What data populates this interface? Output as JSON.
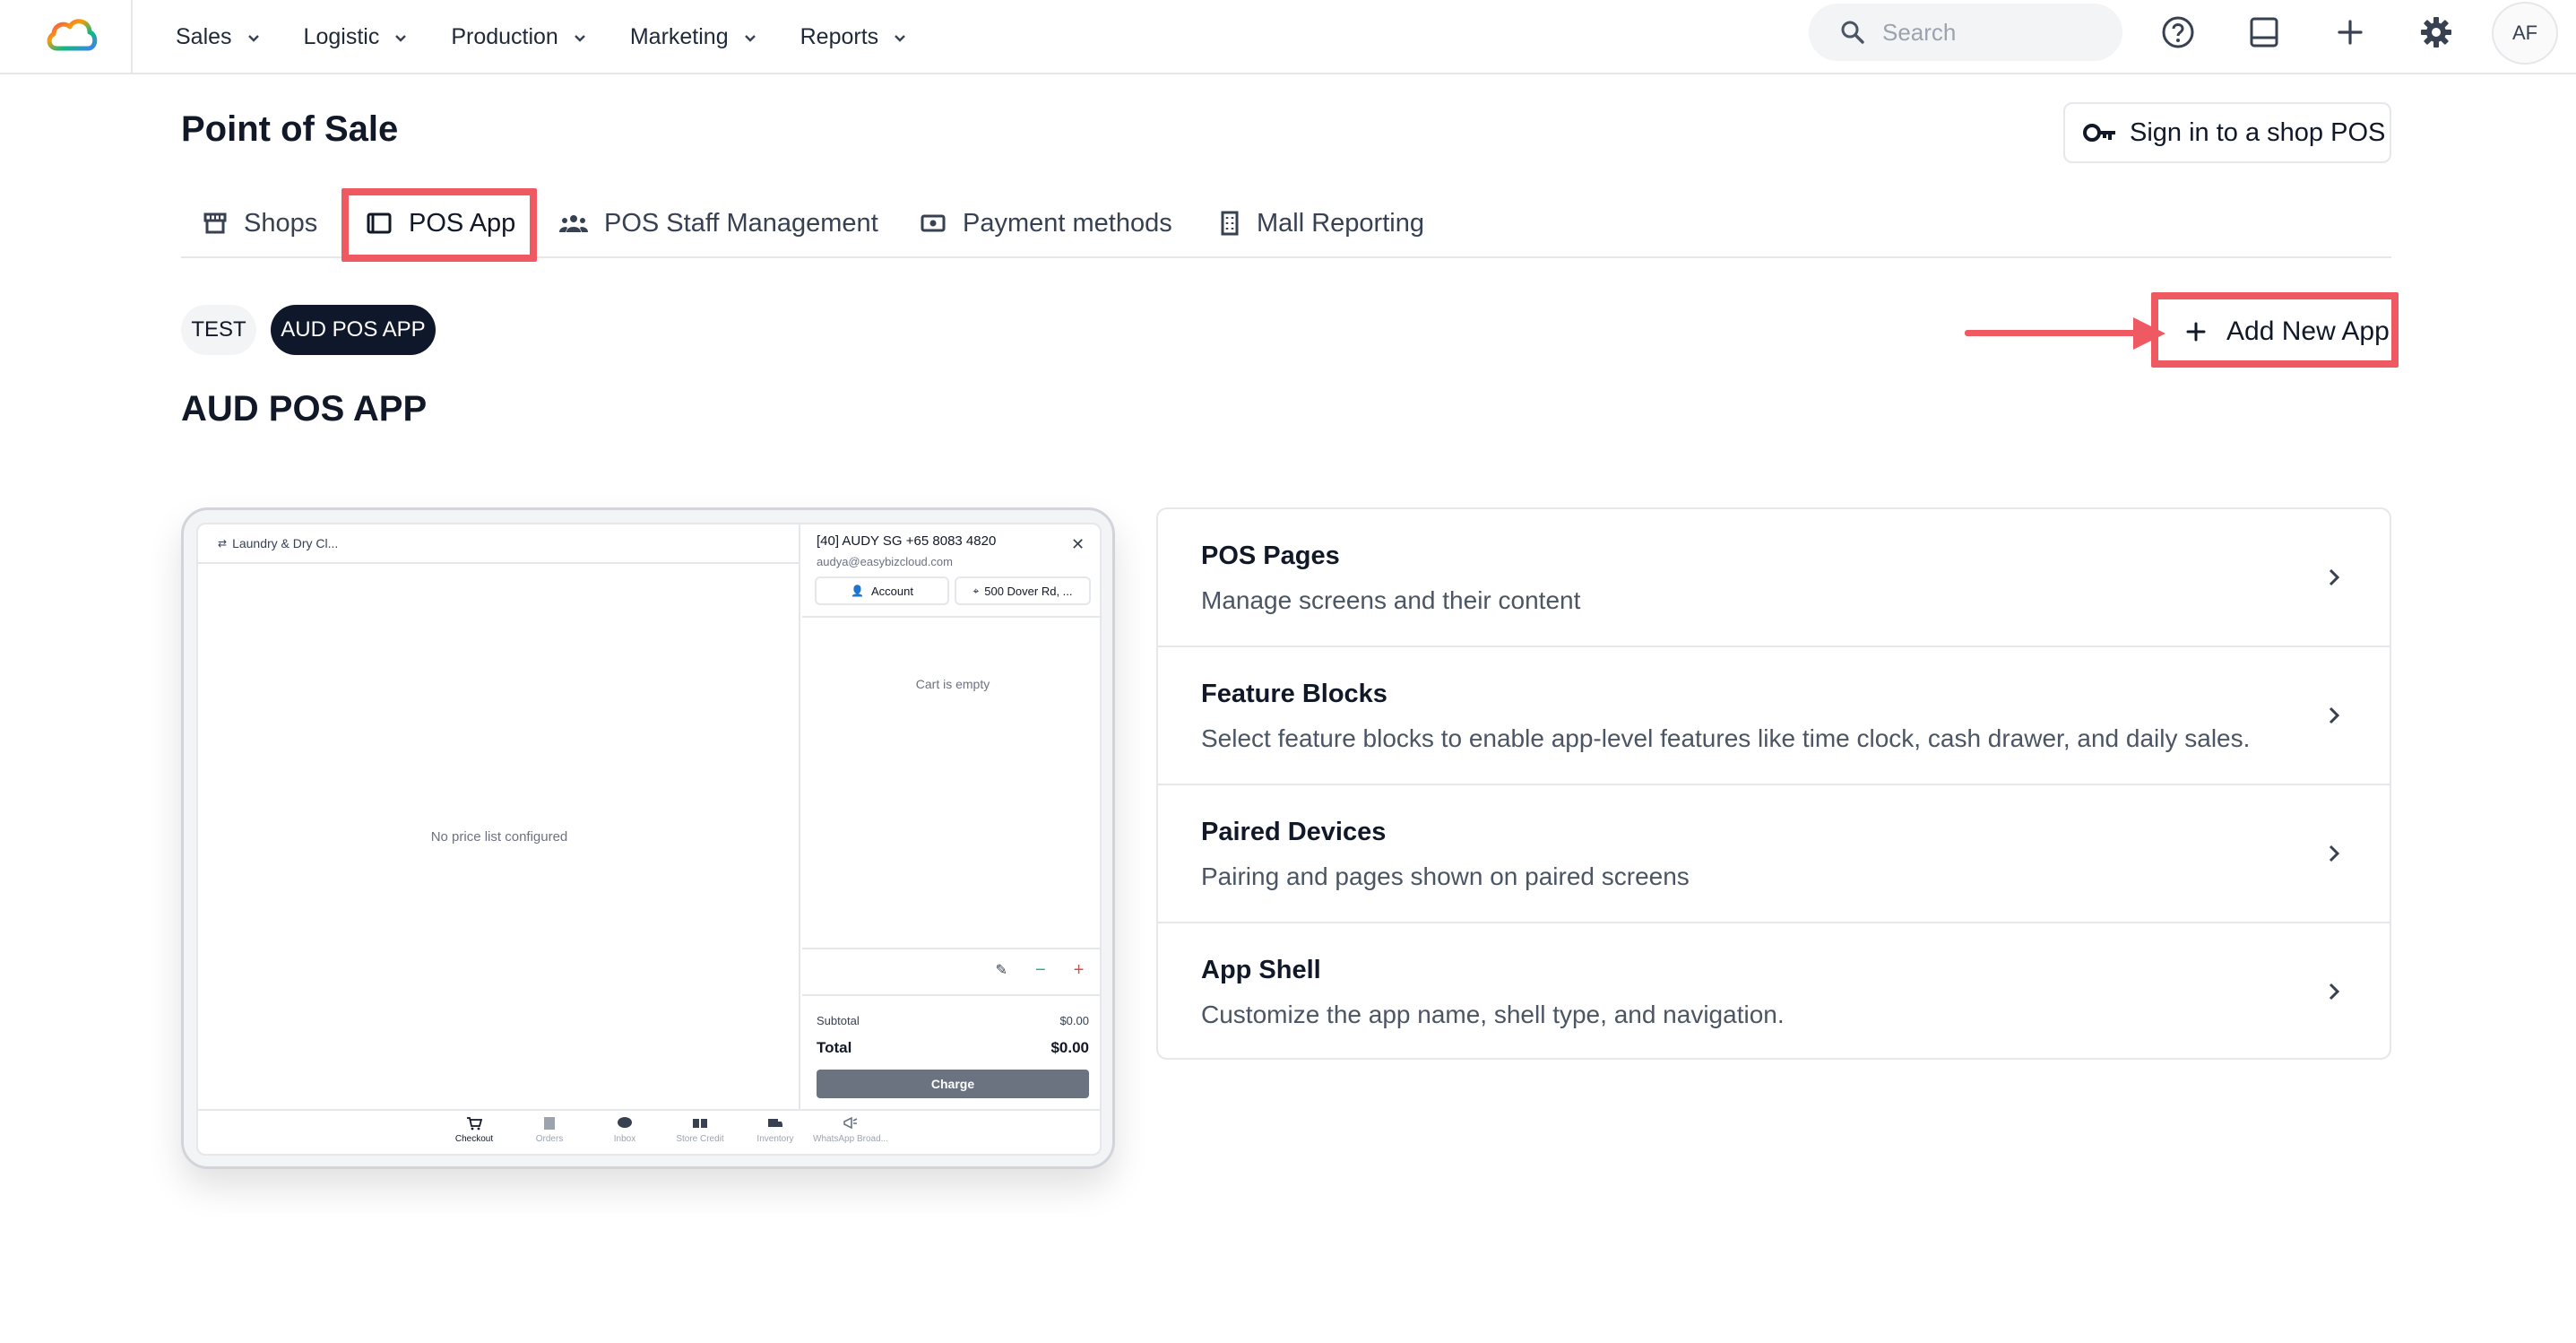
{
  "nav": {
    "items": [
      {
        "label": "Sales"
      },
      {
        "label": "Logistic"
      },
      {
        "label": "Production"
      },
      {
        "label": "Marketing"
      },
      {
        "label": "Reports"
      }
    ],
    "search_placeholder": "Search",
    "avatar_initials": "AF"
  },
  "page": {
    "title": "Point of Sale",
    "signin_label": "Sign in to a shop POS"
  },
  "tabs": [
    {
      "label": "Shops",
      "icon": "shop-icon"
    },
    {
      "label": "POS App",
      "icon": "tablet-icon",
      "active": true
    },
    {
      "label": "POS Staff Management",
      "icon": "staff-icon"
    },
    {
      "label": "Payment methods",
      "icon": "payment-icon"
    },
    {
      "label": "Mall Reporting",
      "icon": "building-icon"
    }
  ],
  "apps": [
    {
      "label": "TEST",
      "active": false
    },
    {
      "label": "AUD POS APP",
      "active": true
    }
  ],
  "add_app_label": "Add New App",
  "section_title": "AUD POS APP",
  "preview": {
    "shop_name": "Laundry & Dry Cl...",
    "no_price": "No price list configured",
    "customer_name": "[40] AUDY SG +65 8083 4820",
    "customer_email": "audya@easybizcloud.com",
    "account_label": "Account",
    "address_label": "500 Dover Rd, ...",
    "cart_empty": "Cart is empty",
    "subtotal_label": "Subtotal",
    "subtotal_value": "$0.00",
    "total_label": "Total",
    "total_value": "$0.00",
    "charge_label": "Charge",
    "bottom_nav": [
      {
        "label": "Checkout",
        "active": true
      },
      {
        "label": "Orders"
      },
      {
        "label": "Inbox"
      },
      {
        "label": "Store Credit"
      },
      {
        "label": "Inventory"
      },
      {
        "label": "WhatsApp Broad..."
      }
    ]
  },
  "cards": [
    {
      "title": "POS Pages",
      "desc": "Manage screens and their content"
    },
    {
      "title": "Feature Blocks",
      "desc": "Select feature blocks to enable app-level features like time clock, cash drawer, and daily sales."
    },
    {
      "title": "Paired Devices",
      "desc": "Pairing and pages shown on paired screens"
    },
    {
      "title": "App Shell",
      "desc": "Customize the app name, shell type, and navigation."
    }
  ],
  "colors": {
    "highlight": "#ef5a62",
    "active_pill": "#0f172a"
  }
}
